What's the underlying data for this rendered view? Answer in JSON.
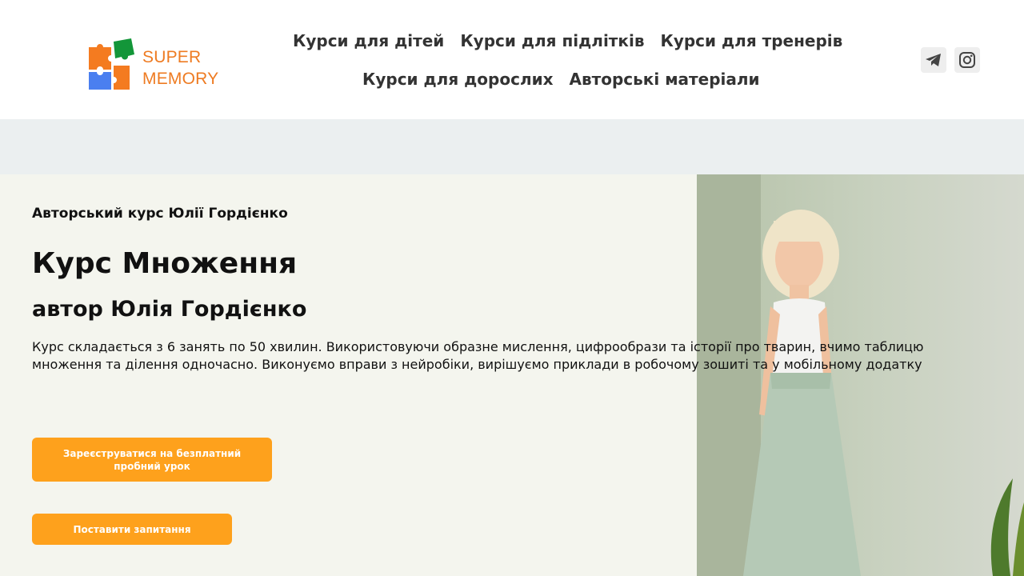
{
  "logo": {
    "line1": "SUPER",
    "line2": "MEMORY",
    "colors": [
      "#ee7b22",
      "#139639",
      "#4a7ff0",
      "#f47b20"
    ]
  },
  "nav": {
    "row1": [
      "Курси для дітей",
      "Курси для підлітків",
      "Курси для тренерів"
    ],
    "row2": [
      "Курси для дорослих",
      "Авторські матеріали"
    ]
  },
  "social": {
    "telegram_icon": "telegram-icon",
    "instagram_icon": "instagram-icon"
  },
  "hero": {
    "subtitle": "Авторський курс Юлії Гордієнко",
    "title": "Курс Множення",
    "author": "автор Юлія Гордієнко",
    "description": "Курс складається з 6 занять по 50 хвилин. Використовуючи образне мислення, цифрообрази та історії про тварин, вчимо таблицю множення та ділення одночасно. Виконуємо вправи з нейробіки, вирішуємо приклади в робочому зошиті та у  мобільному додатку",
    "button_trial": "Зареєструватися на безплатний пробний урок",
    "button_question": "Поставити запитання"
  },
  "colors": {
    "accent": "#fea11c",
    "hero_bg": "#f4f5ee",
    "band_bg": "#ebeff0"
  }
}
